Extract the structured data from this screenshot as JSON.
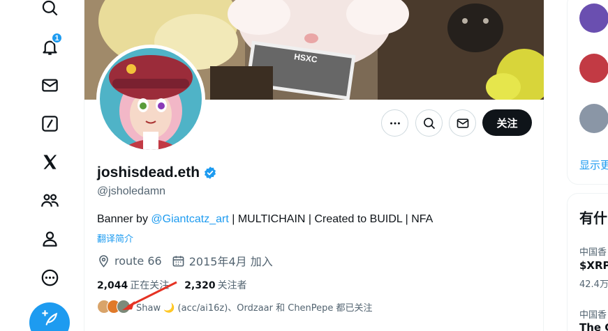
{
  "nav": {
    "items": [
      {
        "name": "search-icon"
      },
      {
        "name": "bell-icon",
        "badge": "1"
      },
      {
        "name": "mail-icon"
      },
      {
        "name": "grok-icon"
      },
      {
        "name": "x-logo-icon"
      },
      {
        "name": "communities-icon"
      },
      {
        "name": "profile-icon"
      },
      {
        "name": "more-icon"
      }
    ],
    "post_button_icon": "feather-plus-icon"
  },
  "profile": {
    "banner_text": "HSXC",
    "name": "joshisdead.eth",
    "verified": true,
    "handle": "@jsholedamn",
    "bio_prefix": "Banner by ",
    "bio_link": "@Giantcatz_art",
    "bio_suffix": " | MULTICHAIN | Created to BUIDL | NFA",
    "translate": "翻译简介",
    "location": "route 66",
    "joined": "2015年4月 加入",
    "following_count": "2,044",
    "following_label": "正在关注",
    "followers_count": "2,320",
    "followers_label": "关注者",
    "followed_by": "Shaw 🌙 (acc/ai16z)、Ordzaar 和 ChenPepe 都已关注"
  },
  "actions": {
    "more_icon": "ellipsis-icon",
    "search_icon": "search-icon",
    "message_icon": "mail-icon",
    "follow_label": "关注"
  },
  "right": {
    "show_more": "显示更",
    "trends_title": "有什",
    "trend1_context": "中国香",
    "trend1_title": "$XRP",
    "trend1_count": "42.4万",
    "trend2_context": "中国香",
    "trend2_title": "The C"
  },
  "colors": {
    "accent": "#1d9bf0",
    "text": "#0f1419",
    "muted": "#536471",
    "arrow": "#e53223"
  }
}
